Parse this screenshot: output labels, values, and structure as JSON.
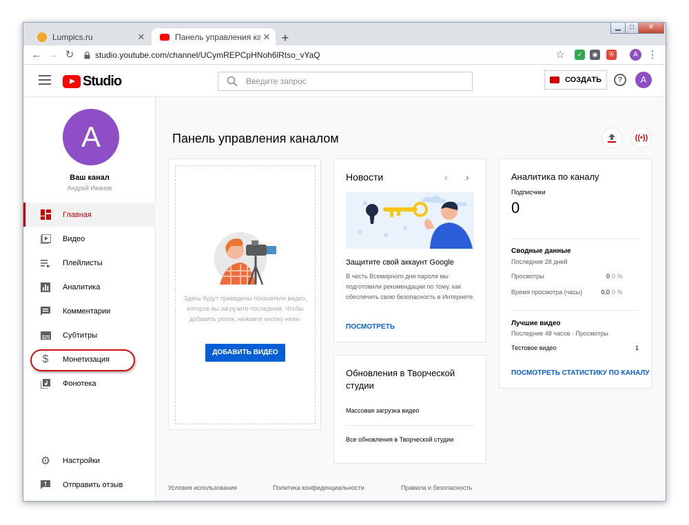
{
  "browser": {
    "tabs": [
      {
        "title": "Lumpics.ru",
        "color": "#f5a623"
      },
      {
        "title": "Панель управления каналом - Yo",
        "color": "#ff0000"
      }
    ],
    "url": "studio.youtube.com/channel/UCymREPCpHNoh6lRtso_vYaQ",
    "profile_initial": "A"
  },
  "header": {
    "logo_text": "Studio",
    "search_placeholder": "Введите запрос",
    "create_label": "СОЗДАТЬ",
    "avatar_initial": "A"
  },
  "sidebar": {
    "avatar_initial": "A",
    "channel_name": "Ваш канал",
    "owner": "Андрей Иванов",
    "items": [
      {
        "label": "Главная",
        "icon": "dashboard-icon"
      },
      {
        "label": "Видео",
        "icon": "video-icon"
      },
      {
        "label": "Плейлисты",
        "icon": "playlist-icon"
      },
      {
        "label": "Аналитика",
        "icon": "analytics-icon"
      },
      {
        "label": "Комментарии",
        "icon": "comments-icon"
      },
      {
        "label": "Субтитры",
        "icon": "subtitles-icon"
      },
      {
        "label": "Монетизация",
        "icon": "dollar-icon"
      },
      {
        "label": "Фонотека",
        "icon": "music-library-icon"
      }
    ],
    "bottom_items": [
      {
        "label": "Настройки",
        "icon": "gear-icon"
      },
      {
        "label": "Отправить отзыв",
        "icon": "feedback-icon"
      }
    ]
  },
  "main": {
    "title": "Панель управления каналом",
    "upload_card": {
      "text": "Здесь будут приведены показатели видео, которое вы загрузите последним. Чтобы добавить ролик, нажмите кнопку ниже.",
      "button": "ДОБАВИТЬ ВИДЕО"
    },
    "news": {
      "title": "Новости",
      "headline": "Защитите свой аккаунт Google",
      "body": "В честь Всемирного дня пароля мы подготовили рекомендации по тому, как обеспечить свою безопасность в Интернете.",
      "link": "ПОСМОТРЕТЬ"
    },
    "updates": {
      "title": "Обновления в Творческой студии",
      "items": [
        "Массовая загрузка видео",
        "Все обновления в Творческой студии"
      ]
    },
    "analytics": {
      "title": "Аналитика по каналу",
      "subscribers_label": "Подписчики",
      "subscribers_value": "0",
      "summary_title": "Сводные данные",
      "summary_period": "Последние 28 дней",
      "rows": [
        {
          "label": "Просмотры",
          "value": "0",
          "delta": "0 %"
        },
        {
          "label": "Время просмотра (часы)",
          "value": "0,0",
          "delta": "0 %"
        }
      ],
      "top_title": "Лучшие видео",
      "top_period": "Последние 48 часов · Просмотры",
      "top_video": {
        "title": "Тестовое видео",
        "views": "1"
      },
      "link": "ПОСМОТРЕТЬ СТАТИСТИКУ ПО КАНАЛУ"
    },
    "footer": [
      "Условия использования",
      "Политика конфиденциальности",
      "Правила и безопасность"
    ]
  }
}
